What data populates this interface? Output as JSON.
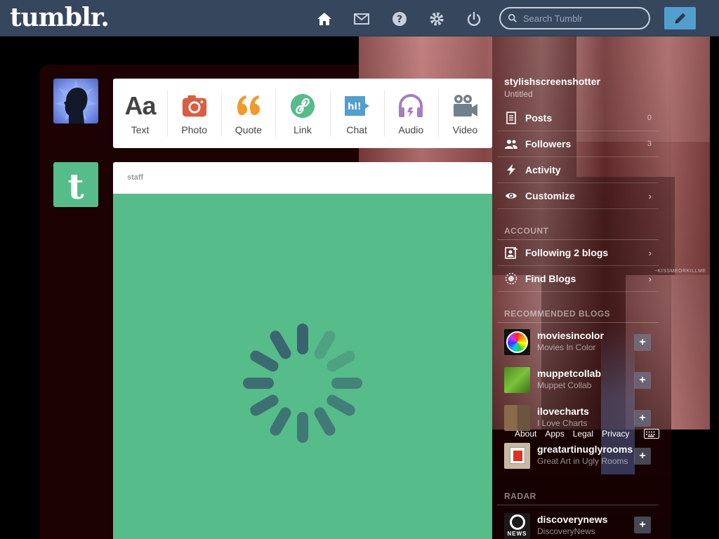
{
  "header": {
    "logo": "tumblr.",
    "search_placeholder": "Search Tumblr",
    "icons": [
      "home-icon",
      "inbox-icon",
      "help-icon",
      "settings-icon",
      "logout-icon",
      "compose-icon"
    ]
  },
  "post_types": [
    {
      "label": "Text",
      "color": "#444444"
    },
    {
      "label": "Photo",
      "color": "#d95e40"
    },
    {
      "label": "Quote",
      "color": "#f2992e"
    },
    {
      "label": "Link",
      "color": "#56bc8a"
    },
    {
      "label": "Chat",
      "color": "#529ecc"
    },
    {
      "label": "Audio",
      "color": "#a77dc2"
    },
    {
      "label": "Video",
      "color": "#748089"
    }
  ],
  "post": {
    "author": "staff",
    "body_color": "#56bc8a"
  },
  "sidebar": {
    "blog_name": "stylishscreenshotter",
    "blog_subtitle": "Untitled",
    "items": [
      {
        "label": "Posts",
        "count": "0"
      },
      {
        "label": "Followers",
        "count": "3"
      },
      {
        "label": "Activity"
      },
      {
        "label": "Customize"
      }
    ],
    "account_heading": "ACCOUNT",
    "account_items": [
      {
        "label": "Following 2 blogs"
      },
      {
        "label": "Find Blogs"
      }
    ],
    "recommended_heading": "RECOMMENDED BLOGS",
    "recommended": [
      {
        "name": "moviesincolor",
        "subtitle": "Movies In Color"
      },
      {
        "name": "muppetcollab",
        "subtitle": "Muppet Collab"
      },
      {
        "name": "ilovecharts",
        "subtitle": "I Love Charts"
      },
      {
        "name": "greatartinuglyrooms",
        "subtitle": "Great Art in Ugly Rooms"
      }
    ],
    "radar_heading": "RADAR",
    "radar": {
      "name": "discoverynews",
      "subtitle": "DiscoveryNews",
      "logo_text": "NEWS"
    },
    "footer_links": [
      "About",
      "Apps",
      "Legal",
      "Privacy"
    ],
    "watermark": "~KISSMEORKILLME"
  },
  "colors": {
    "header_bg": "#36465d",
    "accent_blue": "#529ecc"
  }
}
